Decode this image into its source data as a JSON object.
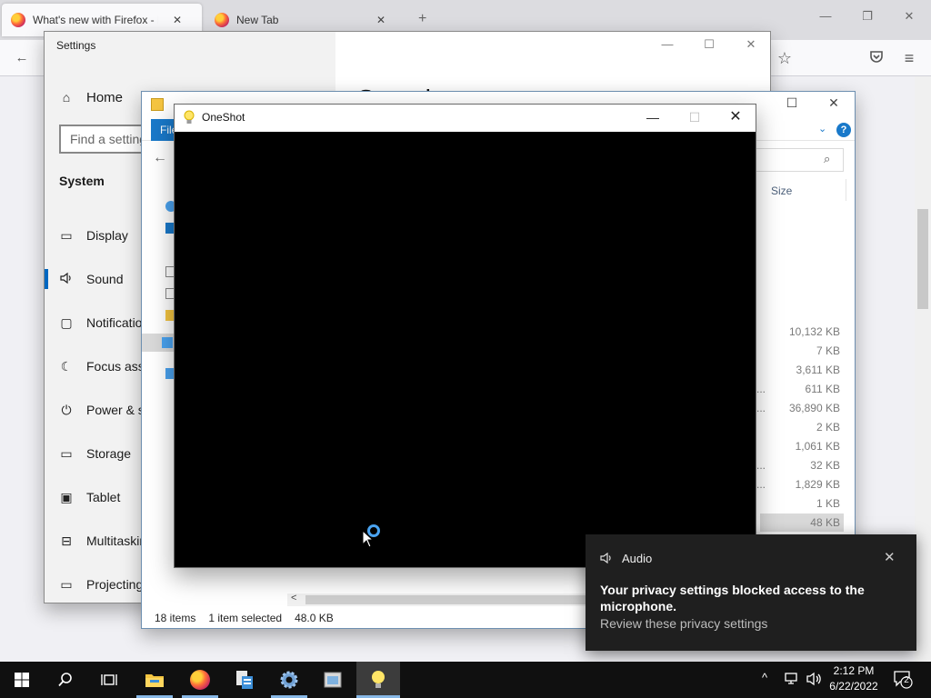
{
  "firefox": {
    "tabs": [
      {
        "title": "What's new with Firefox - More",
        "close": "✕"
      },
      {
        "title": "New Tab",
        "close": "✕"
      }
    ],
    "new_tab_icon": "+",
    "window_controls": {
      "minimize": "—",
      "restore": "❐",
      "close": "✕"
    },
    "nav": {
      "back": "←",
      "star": "☆",
      "pocket": "pocket-icon",
      "menu": "≡"
    }
  },
  "settings": {
    "title": "Settings",
    "controls": {
      "minimize": "—",
      "maximize": "☐",
      "close": "✕"
    },
    "home": "Home",
    "search_placeholder": "Find a setting",
    "section": "System",
    "items": [
      {
        "label": "Display",
        "icon": "▭"
      },
      {
        "label": "Sound",
        "icon": "🔈"
      },
      {
        "label": "Notifications & actions",
        "icon": "▢"
      },
      {
        "label": "Focus assist",
        "icon": "☾"
      },
      {
        "label": "Power & sleep",
        "icon": "⏻"
      },
      {
        "label": "Storage",
        "icon": "▭"
      },
      {
        "label": "Tablet",
        "icon": "▣"
      },
      {
        "label": "Multitasking",
        "icon": "⊟"
      },
      {
        "label": "Projecting to this PC",
        "icon": "▭"
      }
    ],
    "page_heading": "Sound"
  },
  "explorer": {
    "controls": {
      "maximize": "☐",
      "close": "✕"
    },
    "file_tab": "File",
    "help": "?",
    "column_size": "Size",
    "sizes": [
      "10,132 KB",
      "7 KB",
      "3,611 KB",
      "611 KB",
      "36,890 KB",
      "2 KB",
      "1,061 KB",
      "32 KB",
      "1,829 KB",
      "1 KB",
      "48 KB"
    ],
    "truncated_marks": [
      "...",
      "...",
      "...",
      "..."
    ],
    "status": {
      "items": "18 items",
      "selected": "1 item selected",
      "size": "48.0 KB"
    },
    "scroll_left": "<"
  },
  "oneshot": {
    "title": "OneShot",
    "controls": {
      "minimize": "—",
      "maximize": "☐",
      "close": "✕"
    }
  },
  "toast": {
    "app": "Audio",
    "message": "Your privacy settings blocked access to the microphone.",
    "link": "Review these privacy settings",
    "close": "✕"
  },
  "taskbar": {
    "clock_time": "2:12 PM",
    "clock_date": "6/22/2022",
    "notification_count": "2",
    "tray_chevron": "^"
  },
  "colors": {
    "accent": "#0067c0",
    "explorer_ribbon": "#1979ca",
    "taskbar": "#101010",
    "toast": "#1f1f1f"
  }
}
